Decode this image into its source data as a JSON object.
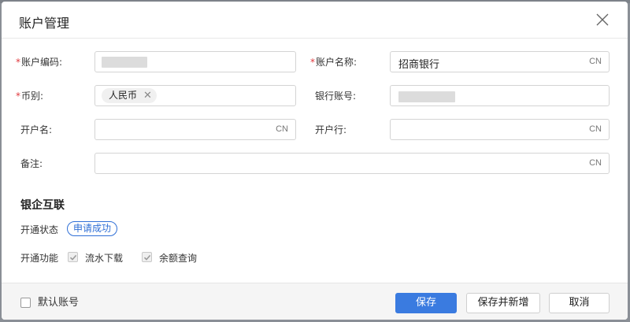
{
  "dialog": {
    "title": "账户管理"
  },
  "form": {
    "account_code": {
      "label": "账户编码:",
      "required": "*",
      "value": ""
    },
    "account_name": {
      "label": "账户名称:",
      "required": "*",
      "value": "招商银行",
      "suffix": "CN"
    },
    "currency": {
      "label": "币别:",
      "required": "*",
      "tag": "人民币",
      "tag_remove": "✕"
    },
    "bank_account": {
      "label": "银行账号:",
      "value": ""
    },
    "account_holder": {
      "label": "开户名:",
      "value": "",
      "suffix": "CN"
    },
    "bank_branch": {
      "label": "开户行:",
      "value": "",
      "suffix": "CN"
    },
    "remark": {
      "label": "备注:",
      "value": "",
      "suffix": "CN"
    }
  },
  "bank_link": {
    "title": "银企互联",
    "status_label": "开通状态",
    "status_value": "申请成功",
    "features_label": "开通功能",
    "features": [
      {
        "label": "流水下载",
        "checked": true
      },
      {
        "label": "余额查询",
        "checked": true
      }
    ]
  },
  "footer": {
    "default_account_label": "默认账号",
    "default_account_checked": false,
    "save_label": "保存",
    "save_new_label": "保存并新增",
    "cancel_label": "取消"
  },
  "colors": {
    "primary": "#3a7be0",
    "required": "#e0393e",
    "badge": "#2f6fd6"
  }
}
